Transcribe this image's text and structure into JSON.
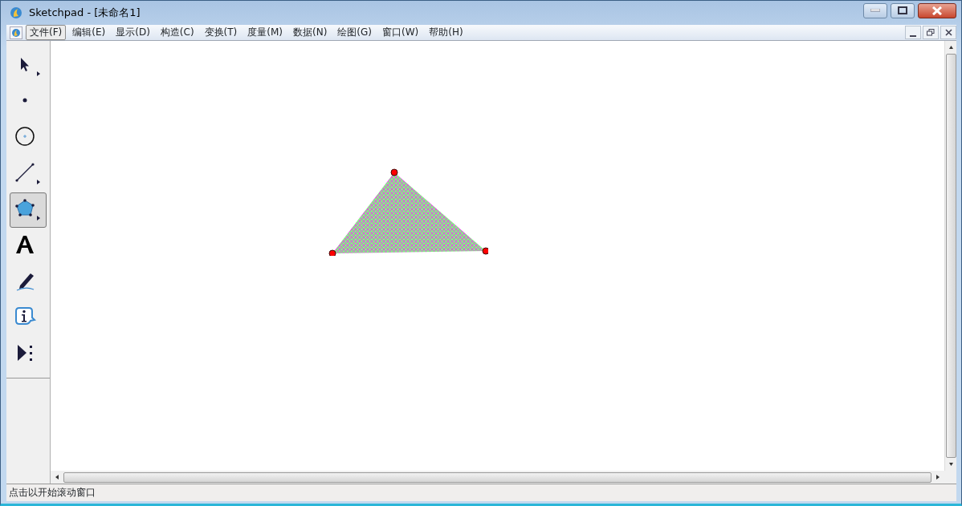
{
  "window": {
    "title": "Sketchpad  - [未命名1]"
  },
  "menu": [
    {
      "label": "文件(F)",
      "selected": true
    },
    {
      "label": "编辑(E)",
      "selected": false
    },
    {
      "label": "显示(D)",
      "selected": false
    },
    {
      "label": "构造(C)",
      "selected": false
    },
    {
      "label": "变换(T)",
      "selected": false
    },
    {
      "label": "度量(M)",
      "selected": false
    },
    {
      "label": "数据(N)",
      "selected": false
    },
    {
      "label": "绘图(G)",
      "selected": false
    },
    {
      "label": "窗口(W)",
      "selected": false
    },
    {
      "label": "帮助(H)",
      "selected": false
    }
  ],
  "tools": [
    {
      "kind": "arrow",
      "selected": false,
      "submenu": true
    },
    {
      "kind": "point",
      "selected": false,
      "submenu": false
    },
    {
      "kind": "compass",
      "selected": false,
      "submenu": false
    },
    {
      "kind": "line",
      "selected": false,
      "submenu": true
    },
    {
      "kind": "polygon",
      "selected": true,
      "submenu": true
    },
    {
      "kind": "text",
      "selected": false,
      "submenu": false
    },
    {
      "kind": "marker",
      "selected": false,
      "submenu": false
    },
    {
      "kind": "info",
      "selected": false,
      "submenu": false
    },
    {
      "kind": "custom",
      "selected": false,
      "submenu": false
    }
  ],
  "status_bar": "点击以开始滚动窗口"
}
